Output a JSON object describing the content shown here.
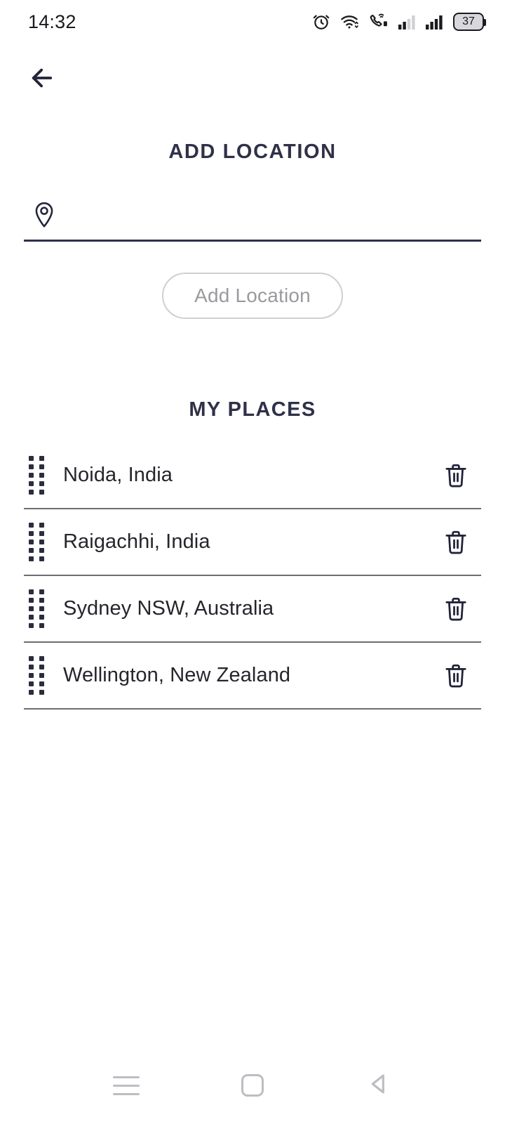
{
  "status_bar": {
    "time": "14:32",
    "battery_level": "37",
    "icons": [
      "alarm-icon",
      "wifi-icon",
      "vowifi-call-icon",
      "signal-bars-1-icon",
      "signal-bars-2-icon",
      "battery-icon"
    ]
  },
  "header": {
    "back_icon": "arrow-left-icon",
    "title": "ADD LOCATION"
  },
  "location_input": {
    "icon": "map-pin-icon",
    "value": "",
    "placeholder": ""
  },
  "add_button": {
    "label": "Add Location"
  },
  "my_places": {
    "title": "MY PLACES",
    "items": [
      {
        "name": "Noida, India",
        "drag_icon": "drag-handle-icon",
        "delete_icon": "trash-icon"
      },
      {
        "name": "Raigachhi, India",
        "drag_icon": "drag-handle-icon",
        "delete_icon": "trash-icon"
      },
      {
        "name": "Sydney NSW, Australia",
        "drag_icon": "drag-handle-icon",
        "delete_icon": "trash-icon"
      },
      {
        "name": "Wellington, New Zealand",
        "drag_icon": "drag-handle-icon",
        "delete_icon": "trash-icon"
      }
    ]
  },
  "nav_bar": {
    "recents_icon": "recents-menu-icon",
    "home_icon": "home-square-icon",
    "back_icon": "back-triangle-icon"
  },
  "colors": {
    "accent_dark": "#2e3147",
    "text_primary": "#25262c",
    "muted": "#9a9a9e",
    "divider": "#6d6d72",
    "nav_icon": "#bdbdc2"
  }
}
